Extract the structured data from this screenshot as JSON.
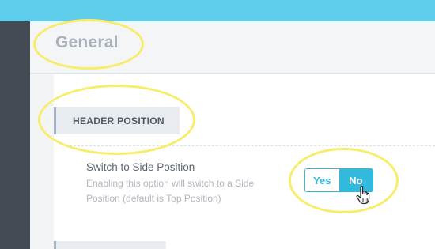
{
  "page": {
    "title": "General"
  },
  "section": {
    "label": "HEADER POSITION"
  },
  "option": {
    "title": "Switch to Side Position",
    "description": "Enabling this option will switch to a Side Position (default is Top Position)",
    "toggle": {
      "yes_label": "Yes",
      "no_label": "No",
      "selected": "No"
    }
  },
  "colors": {
    "topbar": "#5dcdeb",
    "sidebar": "#444b54",
    "accent": "#32b9de",
    "highlight_circle": "#f6ee6a"
  },
  "icons": {
    "cursor": "hand-pointer-icon"
  }
}
